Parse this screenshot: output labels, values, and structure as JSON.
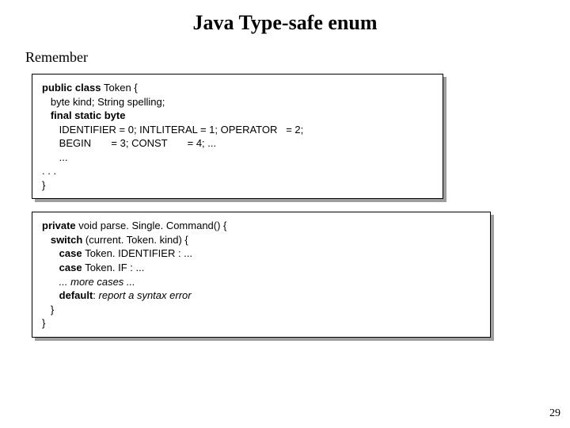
{
  "title": "Java Type-safe enum",
  "remember": "Remember",
  "box1": {
    "l1a": "public class ",
    "l1b": "Token {",
    "l2": "   byte kind; String spelling;",
    "l3": "   final static byte",
    "l4": "      IDENTIFIER = 0; INTLITERAL = 1; OPERATOR   = 2;",
    "l5": "      BEGIN       = 3; CONST       = 4; ...",
    "l6": "      ...",
    "l7": ". . .",
    "l8": "}"
  },
  "box2": {
    "l1a": "private ",
    "l1b": "void parse. Single. Command() {",
    "l2a": "   switch ",
    "l2b": "(current. Token. kind) {",
    "l3a": "      case ",
    "l3b": "Token. IDENTIFIER : ...",
    "l4a": "      case ",
    "l4b": "Token. IF : ...",
    "l5": "      ... more cases ...",
    "l6a": "      default",
    "l6b": ": ",
    "l6c": "report a syntax error",
    "l7": "   }",
    "l8": "}"
  },
  "pagenum": "29"
}
